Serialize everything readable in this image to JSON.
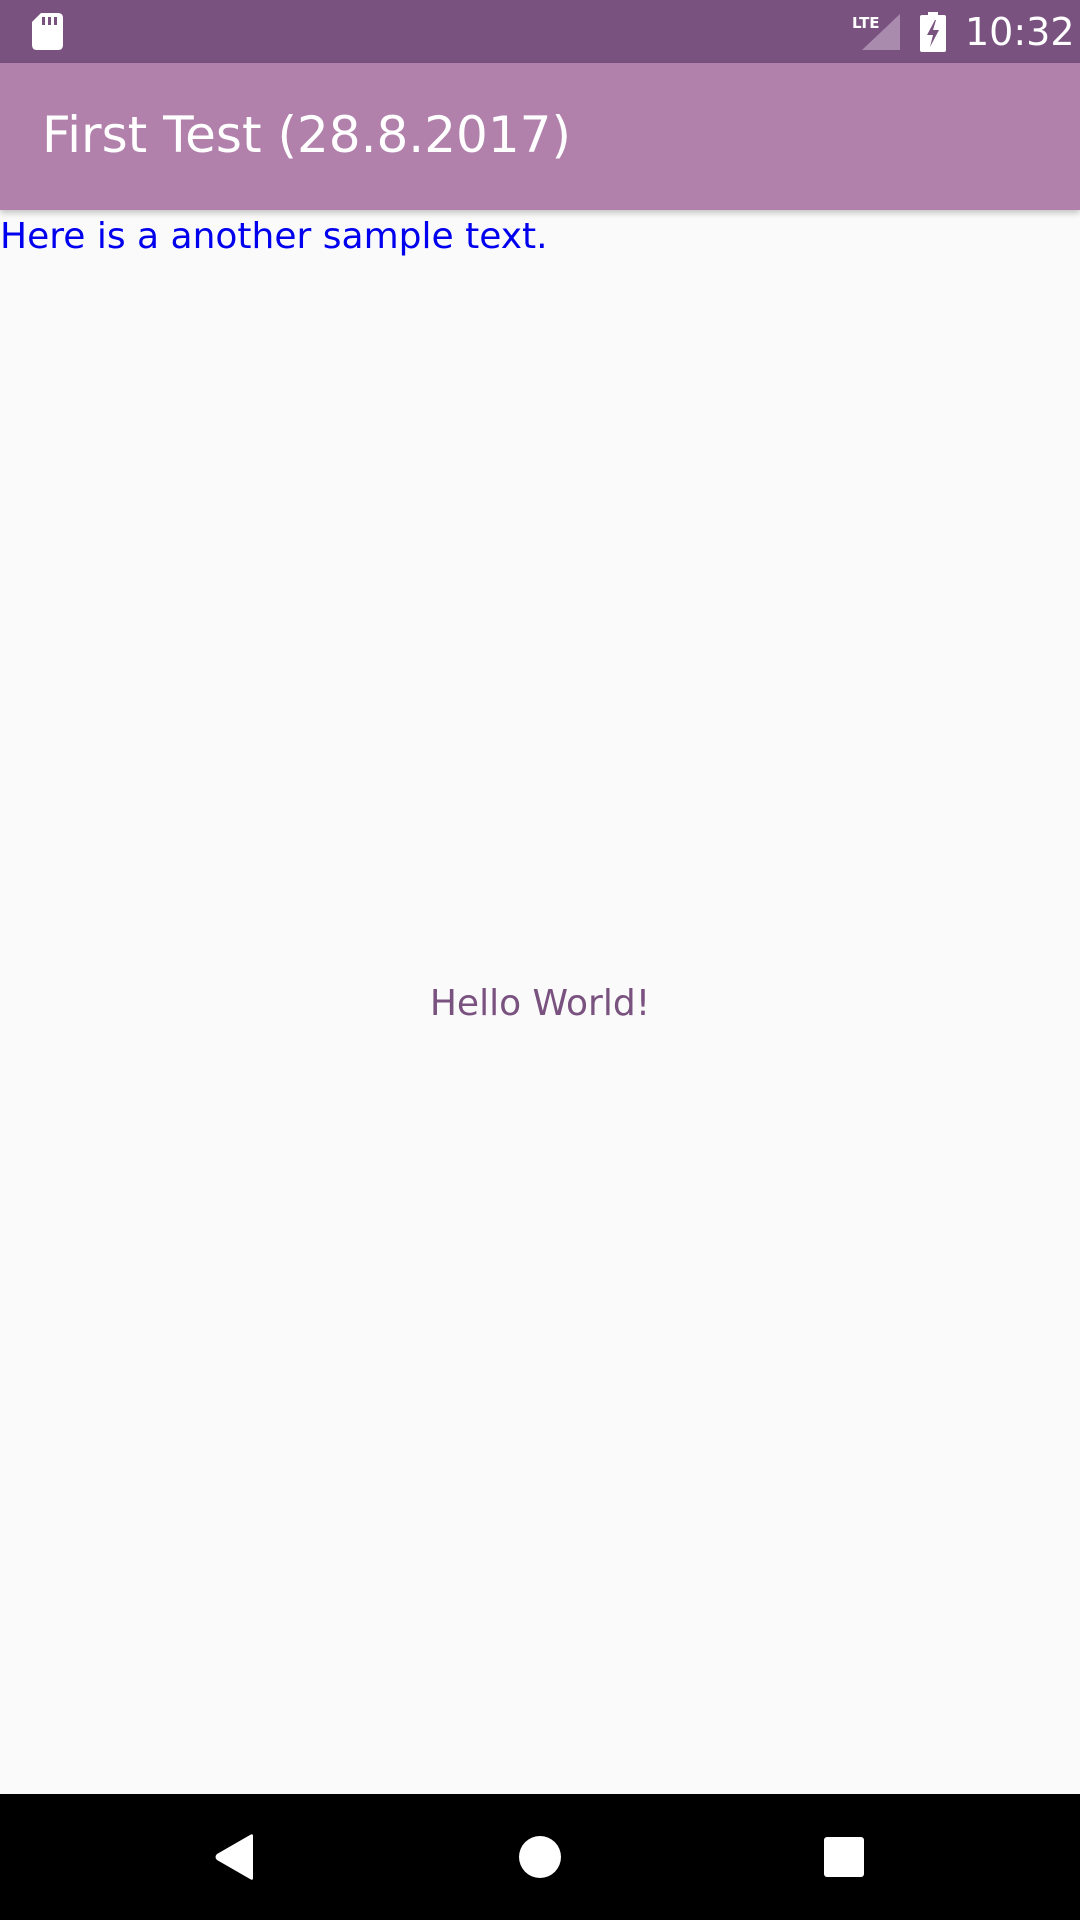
{
  "status_bar": {
    "time": "10:32",
    "network": "LTE",
    "icons": [
      "sd-card-icon",
      "lte-signal-icon",
      "battery-charging-icon"
    ]
  },
  "app_bar": {
    "title": "First Test (28.8.2017)"
  },
  "content": {
    "sample_text": "Here is a another sample text.",
    "hello_text": "Hello World!"
  },
  "nav_bar": {
    "icons": [
      "back-icon",
      "home-icon",
      "recents-icon"
    ]
  },
  "colors": {
    "status_bar": "#7a5280",
    "app_bar": "#b180ab",
    "sample_text": "#0000ee",
    "hello_text": "#7a5280",
    "background": "#fafafa"
  }
}
